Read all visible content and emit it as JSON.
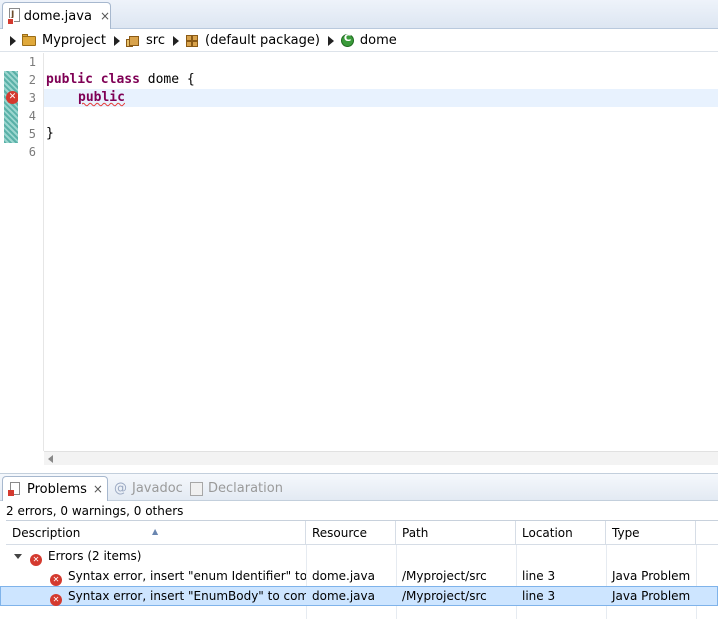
{
  "editor_tab": {
    "title": "dome.java",
    "close": "×"
  },
  "breadcrumb": {
    "project": "Myproject",
    "src": "src",
    "package": "(default package)",
    "class": "dome"
  },
  "editor": {
    "line_numbers": [
      "1",
      "2",
      "3",
      "4",
      "5",
      "6"
    ],
    "line2": {
      "kw1": "public",
      "kw2": "class",
      "rest": " dome {"
    },
    "line3": {
      "kw": "public"
    },
    "line5": "}"
  },
  "views": {
    "problems": "Problems",
    "problems_close": "×",
    "javadoc": "Javadoc",
    "declaration": "Declaration"
  },
  "problems": {
    "summary": "2 errors, 0 warnings, 0 others",
    "columns": [
      "Description",
      "Resource",
      "Path",
      "Location",
      "Type"
    ],
    "group": "Errors (2 items)",
    "rows": [
      {
        "description": "Syntax error, insert \"enum Identifier\" to c",
        "resource": "dome.java",
        "path": "/Myproject/src",
        "location": "line 3",
        "type": "Java Problem"
      },
      {
        "description": "Syntax error, insert \"EnumBody\" to comp",
        "resource": "dome.java",
        "path": "/Myproject/src",
        "location": "line 3",
        "type": "Java Problem"
      }
    ]
  }
}
